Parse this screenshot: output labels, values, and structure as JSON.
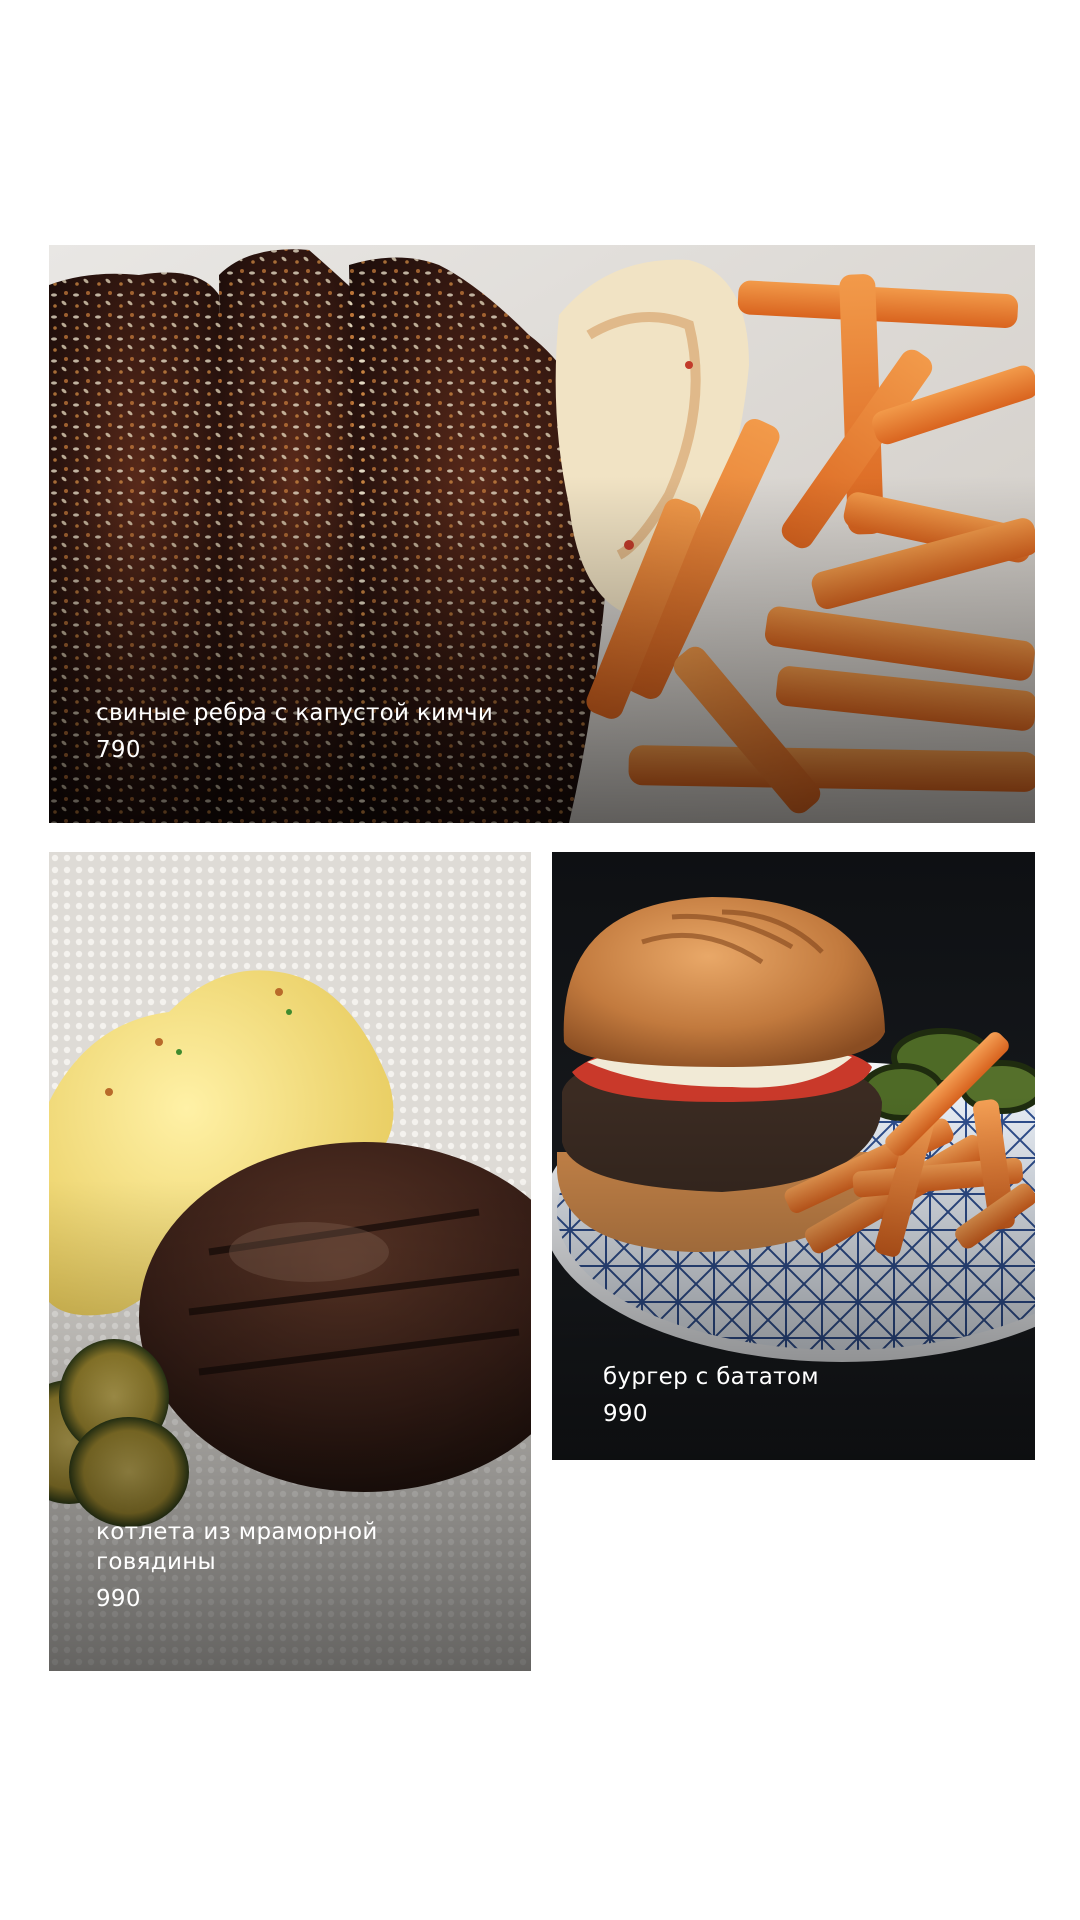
{
  "menu": {
    "items": [
      {
        "title": "свиные ребра с капустой кимчи",
        "price": "790"
      },
      {
        "title": "котлета из мраморной говядины",
        "price": "990"
      },
      {
        "title": "бургер с бататом",
        "price": "990"
      }
    ]
  },
  "colors": {
    "background": "#ffffff",
    "caption_text": "#ffffff"
  }
}
